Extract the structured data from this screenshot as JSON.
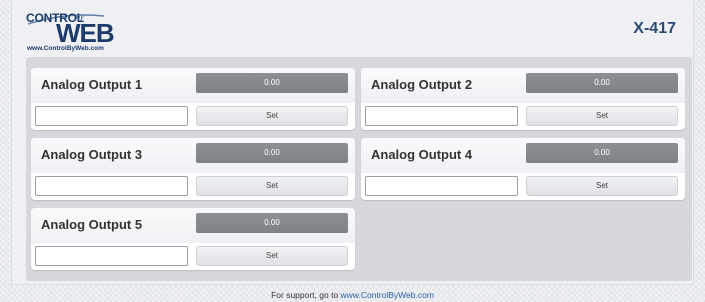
{
  "header": {
    "logo": {
      "line1": "CONTROL",
      "by": "by",
      "line2": "WEB",
      "url": "www.ControlByWeb.com"
    },
    "model": "X-417"
  },
  "outputs": [
    {
      "label": "Analog Output 1",
      "value": "0.00",
      "input_value": "",
      "set_label": "Set"
    },
    {
      "label": "Analog Output 2",
      "value": "0.00",
      "input_value": "",
      "set_label": "Set"
    },
    {
      "label": "Analog Output 3",
      "value": "0.00",
      "input_value": "",
      "set_label": "Set"
    },
    {
      "label": "Analog Output 4",
      "value": "0.00",
      "input_value": "",
      "set_label": "Set"
    },
    {
      "label": "Analog Output 5",
      "value": "0.00",
      "input_value": "",
      "set_label": "Set"
    }
  ],
  "footer": {
    "text": "For support, go to ",
    "link": "www.ControlByWeb.com"
  },
  "colors": {
    "brand": "#1d3b6b",
    "value_bg": "#868a8f",
    "link": "#2b62a8"
  }
}
